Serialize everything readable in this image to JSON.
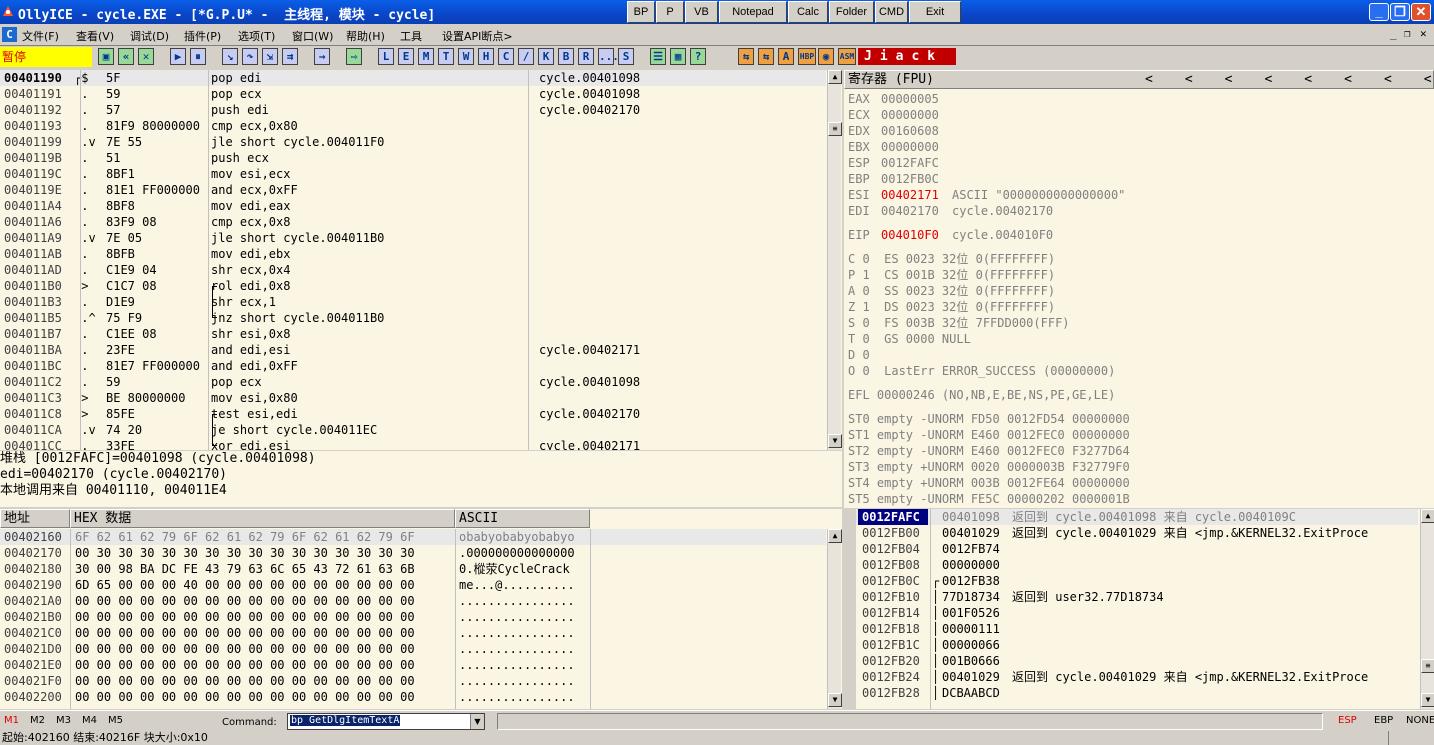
{
  "window": {
    "title": "OllyICE - cycle.EXE - [*G.P.U* -  主线程, 模块 - cycle]"
  },
  "title_buttons": [
    "BP",
    "P",
    "VB",
    "Notepad",
    "Calc",
    "Folder",
    "CMD",
    "Exit"
  ],
  "menu": [
    "文件(F)",
    "查看(V)",
    "调试(D)",
    "插件(P)",
    "选项(T)",
    "窗口(W)",
    "帮助(H)",
    "工具",
    "设置API断点>"
  ],
  "status_paused": "暂停",
  "toolbar_letters": [
    "L",
    "E",
    "M",
    "T",
    "W",
    "H",
    "C",
    "/",
    "K",
    "B",
    "R",
    "...",
    "S"
  ],
  "right_toolbar_labels": [
    "HBP",
    "ASM"
  ],
  "right_toolbar_word": "Jiack",
  "disasm": {
    "rows": [
      {
        "addr": "00401190",
        "hex": "5F",
        "asm": "pop edi",
        "cmt": "cycle.00401098",
        "mark": "┌$"
      },
      {
        "addr": "00401191",
        "hex": "59",
        "asm": "pop ecx",
        "cmt": "cycle.00401098",
        "mark": " ."
      },
      {
        "addr": "00401192",
        "hex": "57",
        "asm": "push edi",
        "cmt": "cycle.00402170",
        "mark": " ."
      },
      {
        "addr": "00401193",
        "hex": "81F9 80000000",
        "asm": "cmp ecx,0x80",
        "cmt": "",
        "mark": " ."
      },
      {
        "addr": "00401199",
        "hex": "7E 55",
        "asm": "jle short cycle.004011F0",
        "cmt": "",
        "mark": " .v"
      },
      {
        "addr": "0040119B",
        "hex": "51",
        "asm": "push ecx",
        "cmt": "",
        "mark": " ."
      },
      {
        "addr": "0040119C",
        "hex": "8BF1",
        "asm": "mov esi,ecx",
        "cmt": "",
        "mark": " ."
      },
      {
        "addr": "0040119E",
        "hex": "81E1 FF000000",
        "asm": "and ecx,0xFF",
        "cmt": "",
        "mark": " ."
      },
      {
        "addr": "004011A4",
        "hex": "8BF8",
        "asm": "mov edi,eax",
        "cmt": "",
        "mark": " ."
      },
      {
        "addr": "004011A6",
        "hex": "83F9 08",
        "asm": "cmp ecx,0x8",
        "cmt": "",
        "mark": " ."
      },
      {
        "addr": "004011A9",
        "hex": "7E 05",
        "asm": "jle short cycle.004011B0",
        "cmt": "",
        "mark": " .v"
      },
      {
        "addr": "004011AB",
        "hex": "8BFB",
        "asm": "mov edi,ebx",
        "cmt": "",
        "mark": " ."
      },
      {
        "addr": "004011AD",
        "hex": "C1E9 04",
        "asm": "shr ecx,0x4",
        "cmt": "",
        "mark": " ."
      },
      {
        "addr": "004011B0",
        "hex": "C1C7 08",
        "asm": "rol edi,0x8",
        "cmt": "",
        "mark": " >"
      },
      {
        "addr": "004011B3",
        "hex": "D1E9",
        "asm": "shr ecx,1",
        "cmt": "",
        "mark": " ."
      },
      {
        "addr": "004011B5",
        "hex": "75 F9",
        "asm": "jnz short cycle.004011B0",
        "cmt": "",
        "mark": " .^"
      },
      {
        "addr": "004011B7",
        "hex": "C1EE 08",
        "asm": "shr esi,0x8",
        "cmt": "",
        "mark": " ."
      },
      {
        "addr": "004011BA",
        "hex": "23FE",
        "asm": "and edi,esi",
        "cmt": "cycle.00402171",
        "mark": " ."
      },
      {
        "addr": "004011BC",
        "hex": "81E7 FF000000",
        "asm": "and edi,0xFF",
        "cmt": "",
        "mark": " ."
      },
      {
        "addr": "004011C2",
        "hex": "59",
        "asm": "pop ecx",
        "cmt": "cycle.00401098",
        "mark": " ."
      },
      {
        "addr": "004011C3",
        "hex": "BE 80000000",
        "asm": "mov esi,0x80",
        "cmt": "",
        "mark": " >"
      },
      {
        "addr": "004011C8",
        "hex": "85FE",
        "asm": "test esi,edi",
        "cmt": "cycle.00402170",
        "mark": " >"
      },
      {
        "addr": "004011CA",
        "hex": "74 20",
        "asm": "je short cycle.004011EC",
        "cmt": "",
        "mark": " .v"
      },
      {
        "addr": "004011CC",
        "hex": "33FE",
        "asm": "xor edi,esi",
        "cmt": "cycle.00402171",
        "mark": " ."
      }
    ]
  },
  "info": {
    "line1": "堆栈 [0012FAFC]=00401098 (cycle.00401098)",
    "line2": "edi=00402170 (cycle.00402170)",
    "line3": "本地调用来自 00401110, 004011E4"
  },
  "registers": {
    "header": "寄存器 (FPU)",
    "lines": [
      {
        "k": "EAX",
        "v": "00000005",
        "c": ""
      },
      {
        "k": "ECX",
        "v": "00000000",
        "c": ""
      },
      {
        "k": "EDX",
        "v": "00160608",
        "c": ""
      },
      {
        "k": "EBX",
        "v": "00000000",
        "c": ""
      },
      {
        "k": "ESP",
        "v": "0012FAFC",
        "c": ""
      },
      {
        "k": "EBP",
        "v": "0012FB0C",
        "c": ""
      },
      {
        "k": "ESI",
        "v": "00402171",
        "c": "ASCII \"0000000000000000\"",
        "red": true
      },
      {
        "k": "EDI",
        "v": "00402170",
        "c": "cycle.00402170"
      }
    ],
    "eip": {
      "k": "EIP",
      "v": "004010F0",
      "c": "cycle.004010F0"
    },
    "flags": [
      "C 0  ES 0023 32位 0(FFFFFFFF)",
      "P 1  CS 001B 32位 0(FFFFFFFF)",
      "A 0  SS 0023 32位 0(FFFFFFFF)",
      "Z 1  DS 0023 32位 0(FFFFFFFF)",
      "S 0  FS 003B 32位 7FFDD000(FFF)",
      "T 0  GS 0000 NULL",
      "D 0",
      "O 0  LastErr ERROR_SUCCESS (00000000)"
    ],
    "efl": "EFL 00000246 (NO,NB,E,BE,NS,PE,GE,LE)",
    "st": [
      "ST0 empty -UNORM FD50 0012FD54 00000000",
      "ST1 empty -UNORM E460 0012FEC0 00000000",
      "ST2 empty -UNORM E460 0012FEC0 F3277D64",
      "ST3 empty +UNORM 0020 0000003B F32779F0",
      "ST4 empty +UNORM 003B 0012FE64 00000000",
      "ST5 empty -UNORM FE5C 00000202 0000001B"
    ]
  },
  "dump": {
    "headers": {
      "addr": "地址",
      "hex": "HEX 数据",
      "ascii": "ASCII"
    },
    "rows": [
      {
        "addr": "00402160",
        "hex": "6F 62 61 62 79 6F 62 61 62 79 6F 62 61 62 79 6F",
        "ascii": "obabyobabyobabyo"
      },
      {
        "addr": "00402170",
        "hex": "00 30 30 30 30 30 30 30 30 30 30 30 30 30 30 30",
        "ascii": ".000000000000000"
      },
      {
        "addr": "00402180",
        "hex": "30 00 98 BA DC FE 43 79 63 6C 65 43 72 61 63 6B",
        "ascii": "0.樅荥CycleCrack"
      },
      {
        "addr": "00402190",
        "hex": "6D 65 00 00 00 40 00 00 00 00 00 00 00 00 00 00",
        "ascii": "me...@.........."
      },
      {
        "addr": "004021A0",
        "hex": "00 00 00 00 00 00 00 00 00 00 00 00 00 00 00 00",
        "ascii": "................"
      },
      {
        "addr": "004021B0",
        "hex": "00 00 00 00 00 00 00 00 00 00 00 00 00 00 00 00",
        "ascii": "................"
      },
      {
        "addr": "004021C0",
        "hex": "00 00 00 00 00 00 00 00 00 00 00 00 00 00 00 00",
        "ascii": "................"
      },
      {
        "addr": "004021D0",
        "hex": "00 00 00 00 00 00 00 00 00 00 00 00 00 00 00 00",
        "ascii": "................"
      },
      {
        "addr": "004021E0",
        "hex": "00 00 00 00 00 00 00 00 00 00 00 00 00 00 00 00",
        "ascii": "................"
      },
      {
        "addr": "004021F0",
        "hex": "00 00 00 00 00 00 00 00 00 00 00 00 00 00 00 00",
        "ascii": "................"
      },
      {
        "addr": "00402200",
        "hex": "00 00 00 00 00 00 00 00 00 00 00 00 00 00 00 00",
        "ascii": "................"
      }
    ]
  },
  "stack": {
    "rows": [
      {
        "addr": "0012FAFC",
        "val": "00401098",
        "cmt": "返回到 cycle.00401098 来自 cycle.0040109C",
        "sel": true
      },
      {
        "addr": "0012FB00",
        "val": "00401029",
        "cmt": "返回到 cycle.00401029 来自 <jmp.&KERNEL32.ExitProce"
      },
      {
        "addr": "0012FB04",
        "val": "0012FB74",
        "cmt": ""
      },
      {
        "addr": "0012FB08",
        "val": "00000000",
        "cmt": ""
      },
      {
        "addr": "0012FB0C",
        "val": "0012FB38",
        "cmt": "",
        "br": "┌"
      },
      {
        "addr": "0012FB10",
        "val": "77D18734",
        "cmt": "返回到 user32.77D18734",
        "br": "│"
      },
      {
        "addr": "0012FB14",
        "val": "001F0526",
        "cmt": "",
        "br": "│"
      },
      {
        "addr": "0012FB18",
        "val": "00000111",
        "cmt": "",
        "br": "│"
      },
      {
        "addr": "0012FB1C",
        "val": "00000066",
        "cmt": "",
        "br": "│"
      },
      {
        "addr": "0012FB20",
        "val": "001B0666",
        "cmt": "",
        "br": "│"
      },
      {
        "addr": "0012FB24",
        "val": "00401029",
        "cmt": "返回到 cycle.00401029 来自 <jmp.&KERNEL32.ExitProce",
        "br": "│"
      },
      {
        "addr": "0012FB28",
        "val": "DCBAABCD",
        "cmt": "",
        "br": "│"
      }
    ]
  },
  "cmdbar": {
    "m_tabs": [
      "M1",
      "M2",
      "M3",
      "M4",
      "M5"
    ],
    "command_label": "Command:",
    "command_value": "bp GetDlgItemTextA",
    "right": [
      "ESP",
      "EBP",
      "NONE"
    ]
  },
  "status": {
    "text": "起始:402160 结束:40216F 块大小:0x10"
  },
  "colors": {
    "title_bg": "#0a46c8",
    "pane_bg": "#fbf5e3",
    "highlight": "#e00000",
    "selected": "#000080"
  }
}
